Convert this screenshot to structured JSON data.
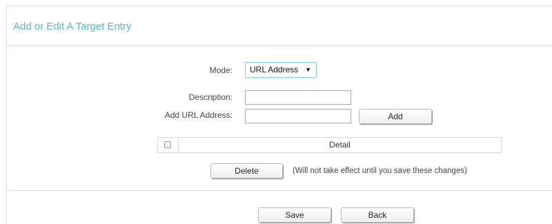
{
  "panel": {
    "title": "Add or Edit A Target Entry"
  },
  "form": {
    "mode_label": "Mode:",
    "mode_value": "URL Address",
    "description_label": "Description:",
    "description_value": "",
    "url_label": "Add URL Address:",
    "url_value": "",
    "add_label": "Add"
  },
  "table": {
    "header": "Detail",
    "checkbox_checked": false
  },
  "actions": {
    "delete_label": "Delete",
    "delete_note": "(Will not take effect until you save these changes)",
    "save_label": "Save",
    "back_label": "Back"
  },
  "colors": {
    "title": "#4fb8d8",
    "select_border": "#7ec8e3"
  },
  "icons": {
    "dropdown": "triangle-down-icon"
  }
}
